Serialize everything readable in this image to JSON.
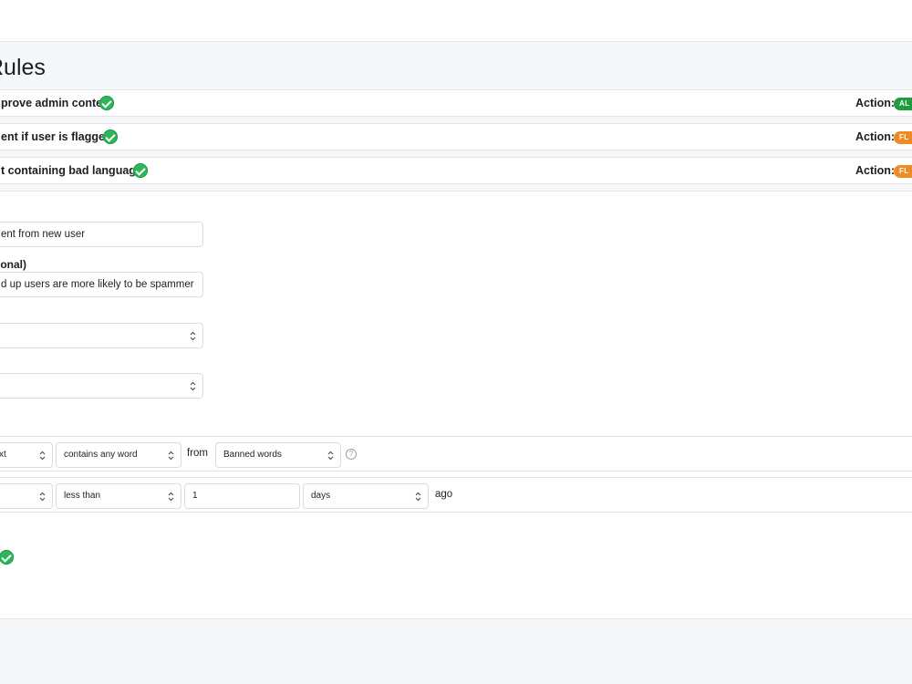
{
  "page": {
    "title": "Rules"
  },
  "rules": [
    {
      "name": "prove admin content",
      "action_label": "Action:",
      "badge": "AL",
      "badge_color": "#1e9c3f"
    },
    {
      "name": "ent if user is flagged",
      "action_label": "Action:",
      "badge": "FL",
      "badge_color": "#f08a24"
    },
    {
      "name": "t containing bad language",
      "action_label": "Action:",
      "badge": "FL",
      "badge_color": "#f08a24"
    }
  ],
  "form": {
    "name_value": "ent from new user",
    "description_label": "ional)",
    "description_value": "d up users are more likely to be spammer",
    "select1_value": "",
    "select2_value": ""
  },
  "conditions": [
    {
      "field": "xt",
      "operator": "contains any word",
      "connector": "from",
      "list": "Banned words",
      "help_icon": "question-circle-icon"
    },
    {
      "field": "",
      "operator": "less than",
      "number": "1",
      "unit": "days",
      "suffix": "ago"
    }
  ],
  "colors": {
    "success": "#2cb75a",
    "allow_badge": "#1e9c3f",
    "flag_badge": "#f08a24"
  }
}
